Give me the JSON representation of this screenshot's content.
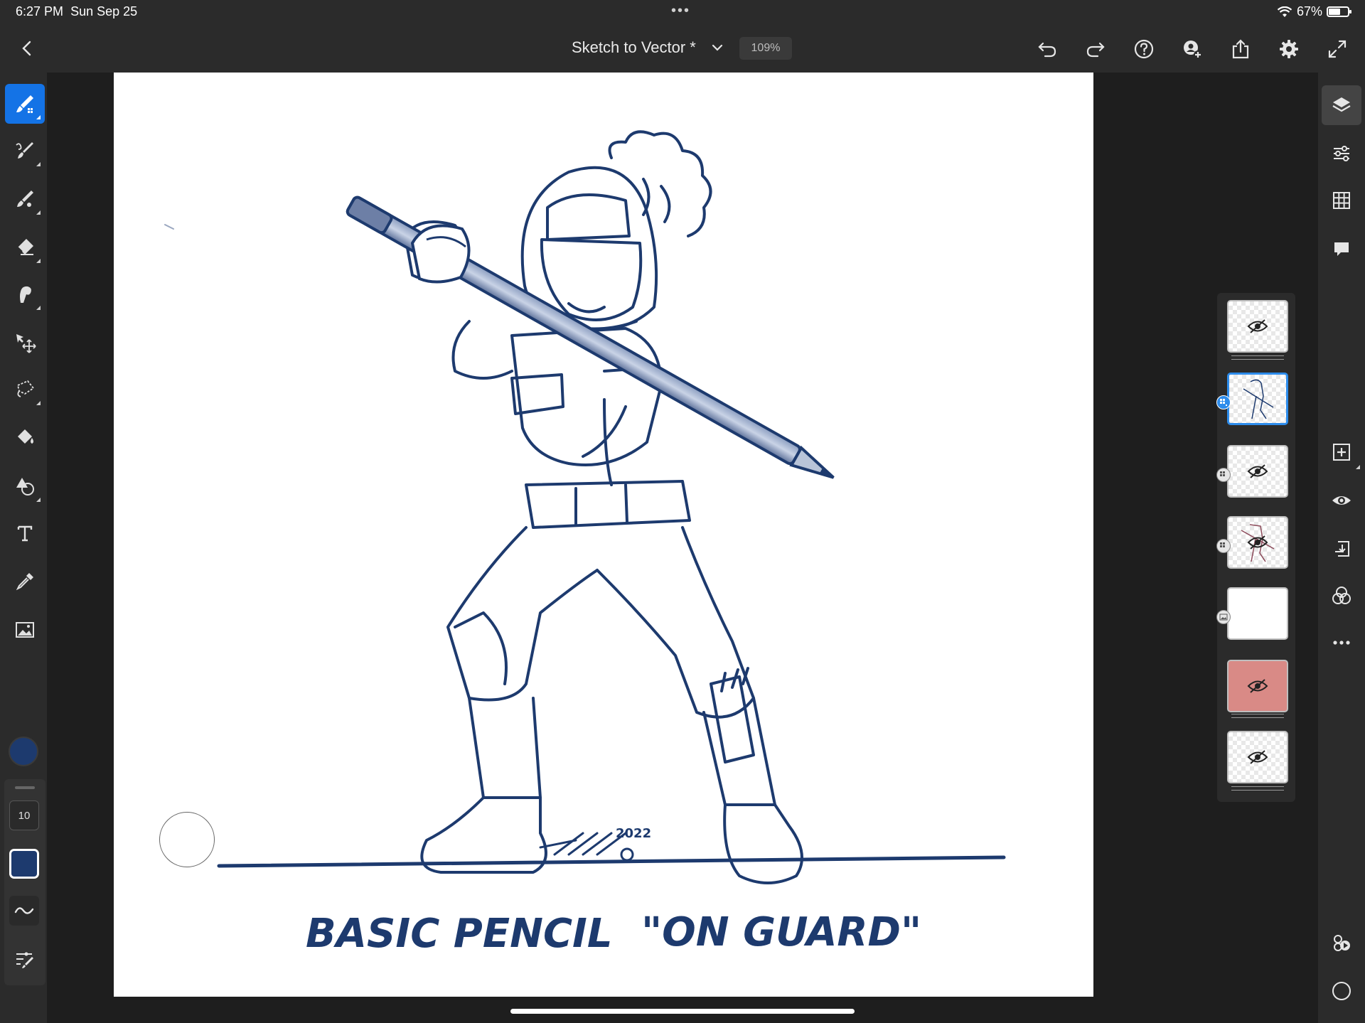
{
  "status_bar": {
    "time": "6:27 PM",
    "date": "Sun Sep 25",
    "battery": "67%",
    "battery_level": 0.67
  },
  "top_bar": {
    "document_title": "Sketch to Vector *",
    "zoom": "109%",
    "actions": [
      "undo-icon",
      "redo-icon",
      "help-icon",
      "invite-icon",
      "share-icon",
      "settings-icon",
      "fullscreen-icon"
    ]
  },
  "left_toolbar": {
    "tools": [
      "pixel-brush",
      "live-brush",
      "vector-brush",
      "eraser",
      "smudge",
      "transform",
      "selection",
      "fill",
      "shapes",
      "text",
      "eyedropper",
      "image"
    ],
    "active_tool": "pixel-brush",
    "brush_size": "10",
    "current_color": "#1d3a6e"
  },
  "canvas": {
    "caption_left": "BASIC PENCIL",
    "caption_right": "\"ON GUARD\"",
    "signature_year": "2022"
  },
  "layers": {
    "count": 7,
    "selected_index": 1
  },
  "right_toolbar": {
    "tools": [
      "layers-icon",
      "layer-properties-icon",
      "grid-icon",
      "comments-icon",
      "add-layer-icon",
      "visibility-icon",
      "merge-down-icon",
      "blend-icon",
      "more-icon",
      "timelapse-icon",
      "record-icon"
    ]
  },
  "colors": {
    "accent": "#1473e6",
    "ink": "#1d3a6e",
    "chrome": "#2b2b2b"
  }
}
